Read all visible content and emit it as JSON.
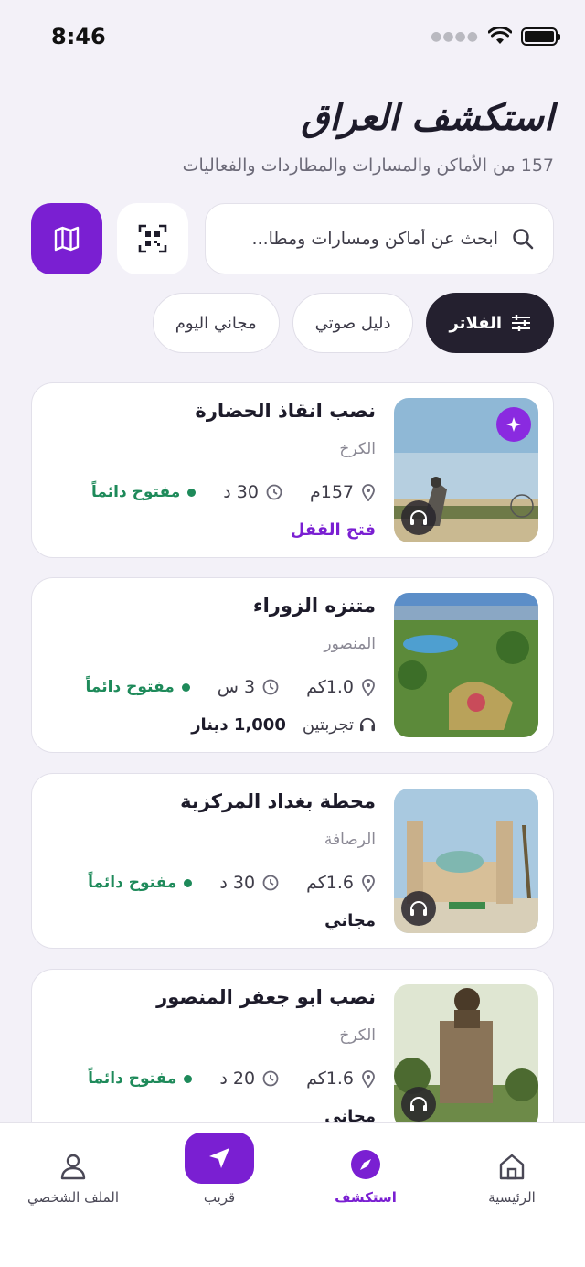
{
  "status_bar": {
    "time": "8:46"
  },
  "header": {
    "title": "استكشف العراق",
    "subtitle": "157 من الأماكن والمسارات والمطاردات والفعاليات"
  },
  "search": {
    "placeholder": "ابحث عن أماكن ومسارات ومطا..."
  },
  "chips": [
    {
      "label": "الفلاتر",
      "active": true
    },
    {
      "label": "دليل صوتي",
      "active": false
    },
    {
      "label": "مجاني اليوم",
      "active": false
    }
  ],
  "places": [
    {
      "title": "نصب انقاذ الحضارة",
      "area": "الكرخ",
      "distance": "157م",
      "duration": "30 د",
      "status": "مفتوح دائماً",
      "footer": "فتح القفل",
      "tries": "",
      "price": ""
    },
    {
      "title": "متنزه الزوراء",
      "area": "المنصور",
      "distance": "1.0كم",
      "duration": "3 س",
      "status": "مفتوح دائماً",
      "footer": "",
      "tries": "تجربتين",
      "price": "1,000 دينار"
    },
    {
      "title": "محطة بغداد المركزية",
      "area": "الرصافة",
      "distance": "1.6كم",
      "duration": "30 د",
      "status": "مفتوح دائماً",
      "footer": "",
      "tries": "",
      "price": "مجاني"
    },
    {
      "title": "نصب ابو جعفر المنصور",
      "area": "الكرخ",
      "distance": "1.6كم",
      "duration": "20 د",
      "status": "مفتوح دائماً",
      "footer": "",
      "tries": "",
      "price": "مجاني"
    }
  ],
  "tabs": {
    "home": "الرئيسية",
    "explore": "استكشف",
    "nearby": "قريب",
    "profile": "الملف الشخصي"
  },
  "colors": {
    "accent": "#7a1fd2",
    "open": "#1e8a5a",
    "dark_chip": "#24202f"
  },
  "icons": [
    "search-icon",
    "qr-code-icon",
    "map-icon",
    "filter-icon",
    "location-pin-icon",
    "clock-icon",
    "headphones-icon",
    "sparkle-icon",
    "home-icon",
    "compass-icon",
    "navigation-arrow-icon",
    "user-icon"
  ]
}
